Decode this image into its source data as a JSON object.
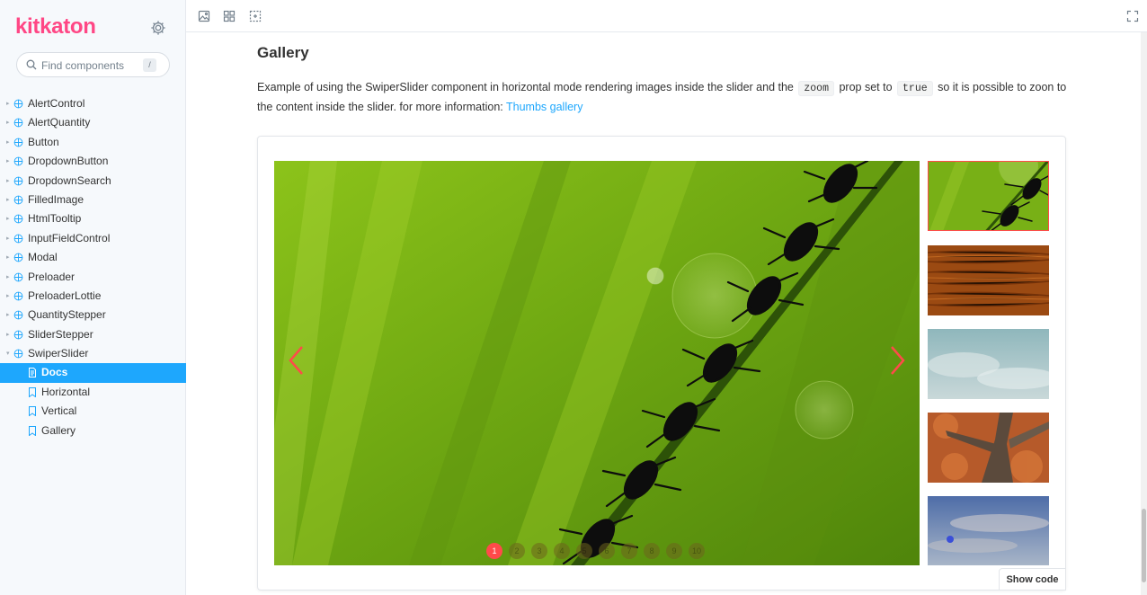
{
  "app": {
    "logo": "kitkaton"
  },
  "search": {
    "placeholder": "Find components",
    "shortcut": "/"
  },
  "tree": {
    "components": [
      {
        "label": "AlertControl"
      },
      {
        "label": "AlertQuantity"
      },
      {
        "label": "Button"
      },
      {
        "label": "DropdownButton"
      },
      {
        "label": "DropdownSearch"
      },
      {
        "label": "FilledImage"
      },
      {
        "label": "HtmlTooltip"
      },
      {
        "label": "InputFieldControl"
      },
      {
        "label": "Modal"
      },
      {
        "label": "Preloader"
      },
      {
        "label": "PreloaderLottie"
      },
      {
        "label": "QuantityStepper"
      },
      {
        "label": "SliderStepper"
      },
      {
        "label": "SwiperSlider",
        "expanded": true
      }
    ],
    "swiper_children": [
      {
        "label": "Docs",
        "selected": true
      },
      {
        "label": "Horizontal"
      },
      {
        "label": "Vertical"
      },
      {
        "label": "Gallery"
      }
    ]
  },
  "toolbar": {
    "icons": [
      "image-icon",
      "grid-icon",
      "outline-icon",
      "fullscreen-icon"
    ]
  },
  "main": {
    "title": "Gallery",
    "desc_part1": "Example of using the SwiperSlider component in horizontal mode rendering images inside the slider and the",
    "code1": "zoom",
    "desc_part2": "prop set to",
    "code2": "true",
    "desc_part3": "so it is possible to zoon to the content inside the slider. for more information:",
    "link_text": "Thumbs gallery"
  },
  "slider": {
    "pages": [
      "1",
      "2",
      "3",
      "4",
      "5",
      "6",
      "7",
      "8",
      "9",
      "10"
    ],
    "active_page": 1,
    "thumbnails": [
      "grass-ants",
      "wood-grain",
      "cloudy-sky",
      "autumn-tree",
      "evening-sky"
    ]
  },
  "show_code_label": "Show code",
  "colors": {
    "brand": "#ff4785",
    "accent": "#1ea7fd",
    "arrow": "#ff4a4a"
  }
}
